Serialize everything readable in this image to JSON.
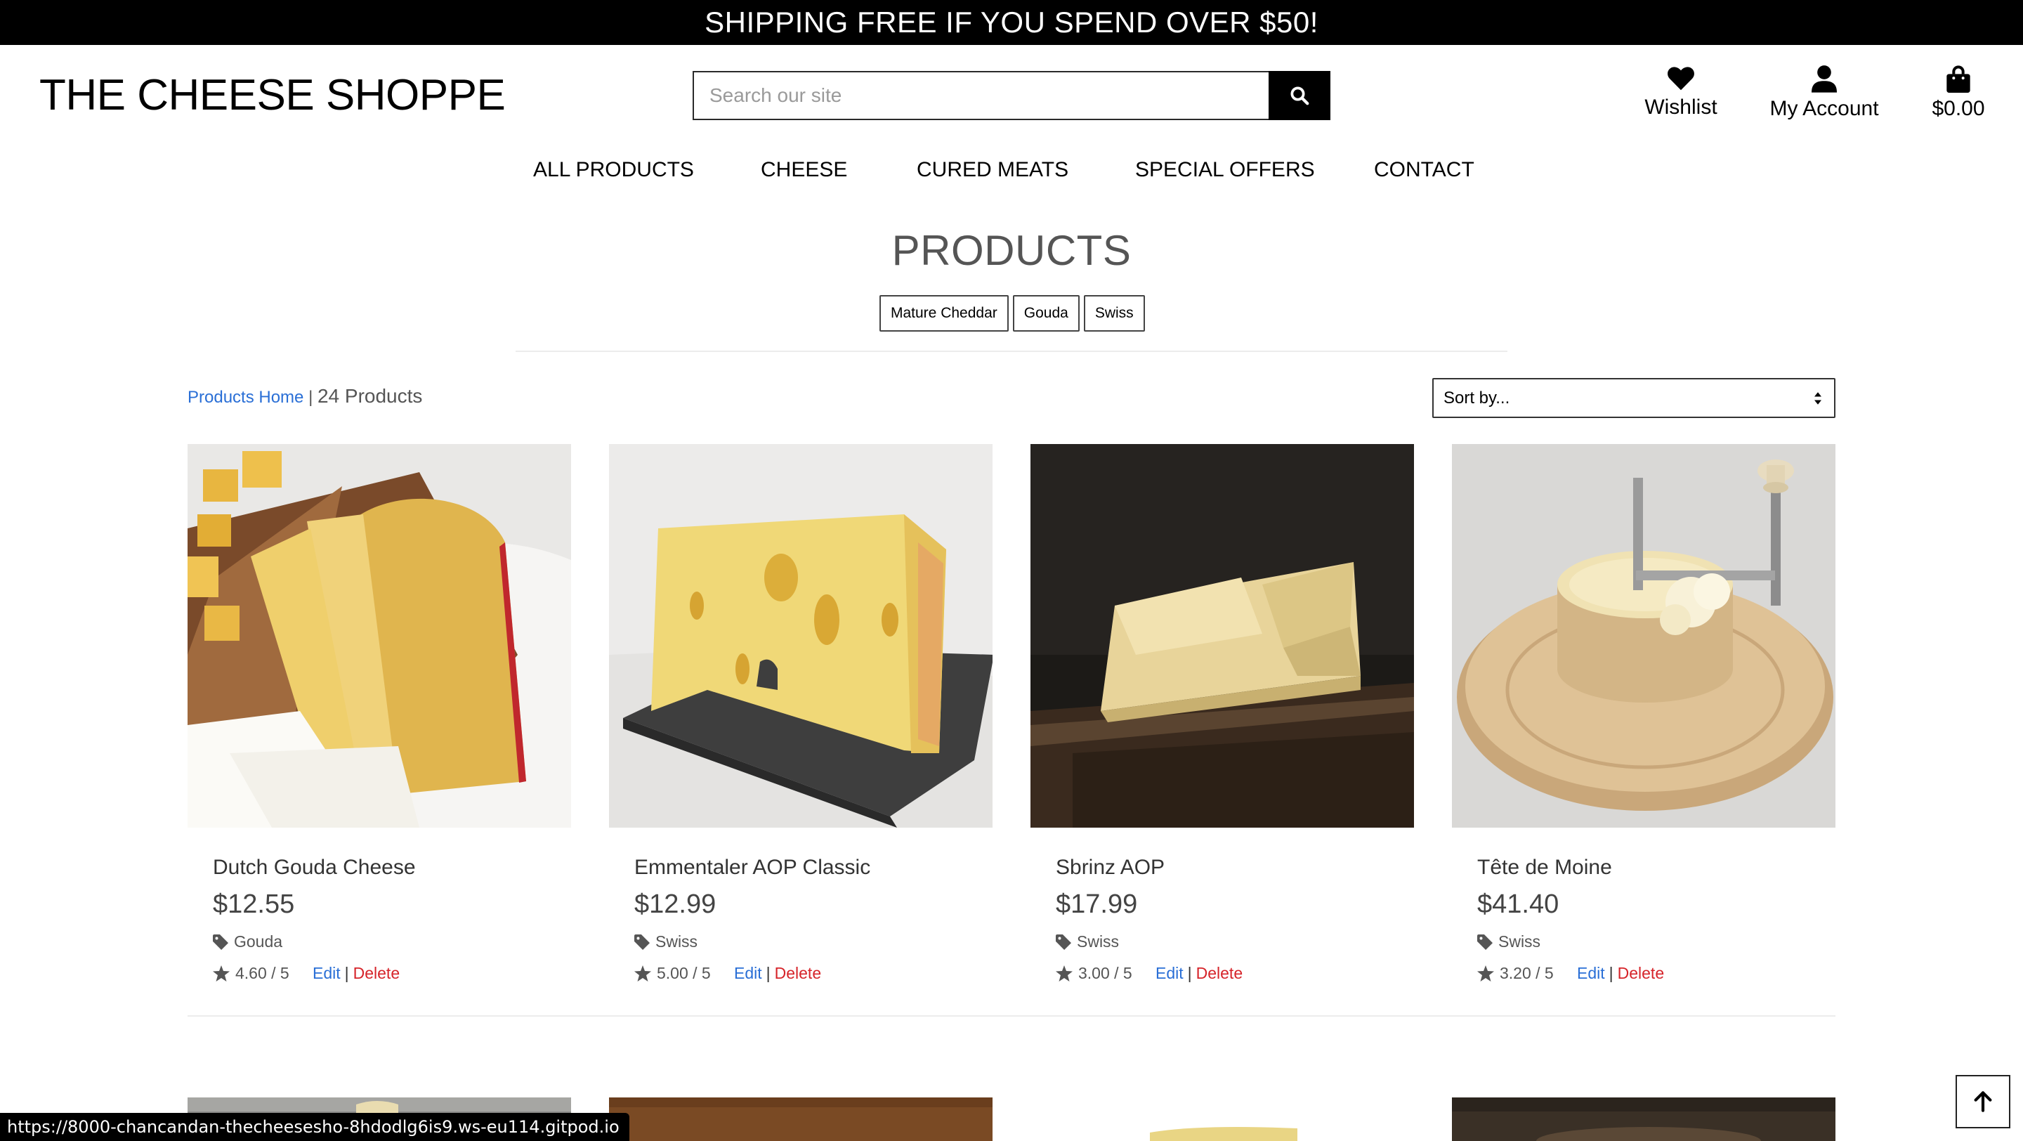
{
  "banner": {
    "text": "SHIPPING FREE IF YOU SPEND OVER $50!"
  },
  "logo": {
    "text": "THE CHEESE SHOPPE"
  },
  "search": {
    "placeholder": "Search our site",
    "icon": "search-icon"
  },
  "header_links": {
    "wishlist": {
      "label": "Wishlist",
      "icon": "heart-icon"
    },
    "account": {
      "label": "My Account",
      "icon": "user-icon"
    },
    "bag": {
      "label": "$0.00",
      "icon": "shopping-bag-icon"
    }
  },
  "nav": [
    "ALL PRODUCTS",
    "CHEESE",
    "CURED MEATS",
    "SPECIAL OFFERS",
    "CONTACT"
  ],
  "page_title": "PRODUCTS",
  "category_tags": [
    "Mature Cheddar",
    "Gouda",
    "Swiss"
  ],
  "breadcrumb": {
    "home": "Products Home",
    "separator": " | ",
    "count": "24 Products"
  },
  "sort": {
    "selected": "Sort by..."
  },
  "products": [
    {
      "name": "Dutch Gouda Cheese",
      "price": "$12.55",
      "category": "Gouda",
      "rating": "4.60 / 5",
      "edit": "Edit",
      "delete": "Delete"
    },
    {
      "name": "Emmentaler AOP Classic",
      "price": "$12.99",
      "category": "Swiss",
      "rating": "5.00 / 5",
      "edit": "Edit",
      "delete": "Delete"
    },
    {
      "name": "Sbrinz AOP",
      "price": "$17.99",
      "category": "Swiss",
      "rating": "3.00 / 5",
      "edit": "Edit",
      "delete": "Delete"
    },
    {
      "name": "Tête de Moine",
      "price": "$41.40",
      "category": "Swiss",
      "rating": "3.20 / 5",
      "edit": "Edit",
      "delete": "Delete"
    }
  ],
  "status_url": "https://8000-chancandan-thecheesesho-8hdodlg6is9.ws-eu114.gitpod.io",
  "colors": {
    "link": "#2a6fd6",
    "delete": "#d6242a",
    "banner_bg": "#000000"
  }
}
